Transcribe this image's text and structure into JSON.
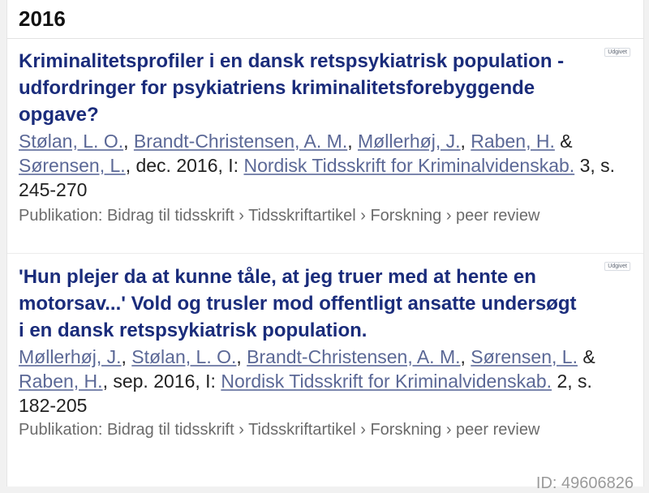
{
  "section": {
    "year": "2016"
  },
  "publications": [
    {
      "title": "Kriminalitetsprofiler i en dansk retspsykiatrisk population - udfordringer for psykiatriens kriminalitetsforebyggende opgave?",
      "status_badge": "Udgivet",
      "authors": [
        "Stølan, L. O.",
        "Brandt-Christensen, A. M.",
        "Møllerhøj, J.",
        "Raben, H.",
        "Sørensen, L."
      ],
      "date_text": ", dec. 2016, I: ",
      "journal": "Nordisk Tidsskrift for Kriminalvidenskab.",
      "issue_pages": " 3, s. 245-270",
      "type_path": "Publikation: Bidrag til tidsskrift › Tidsskriftartikel › Forskning › peer review"
    },
    {
      "title": "'Hun plejer da at kunne tåle, at jeg truer med at hente en motorsav...' Vold og trusler mod offentligt ansatte undersøgt i en dansk retspsykiatrisk population.",
      "status_badge": "Udgivet",
      "authors": [
        "Møllerhøj, J.",
        "Stølan, L. O.",
        "Brandt-Christensen, A. M.",
        "Sørensen, L.",
        "Raben, H."
      ],
      "date_text": ", sep. 2016, I: ",
      "journal": "Nordisk Tidsskrift for Kriminalvidenskab.",
      "issue_pages": " 2, s. 182-205",
      "type_path": "Publikation: Bidrag til tidsskrift › Tidsskriftartikel › Forskning › peer review"
    }
  ],
  "footer": {
    "id_text": "ID: 49606826"
  }
}
